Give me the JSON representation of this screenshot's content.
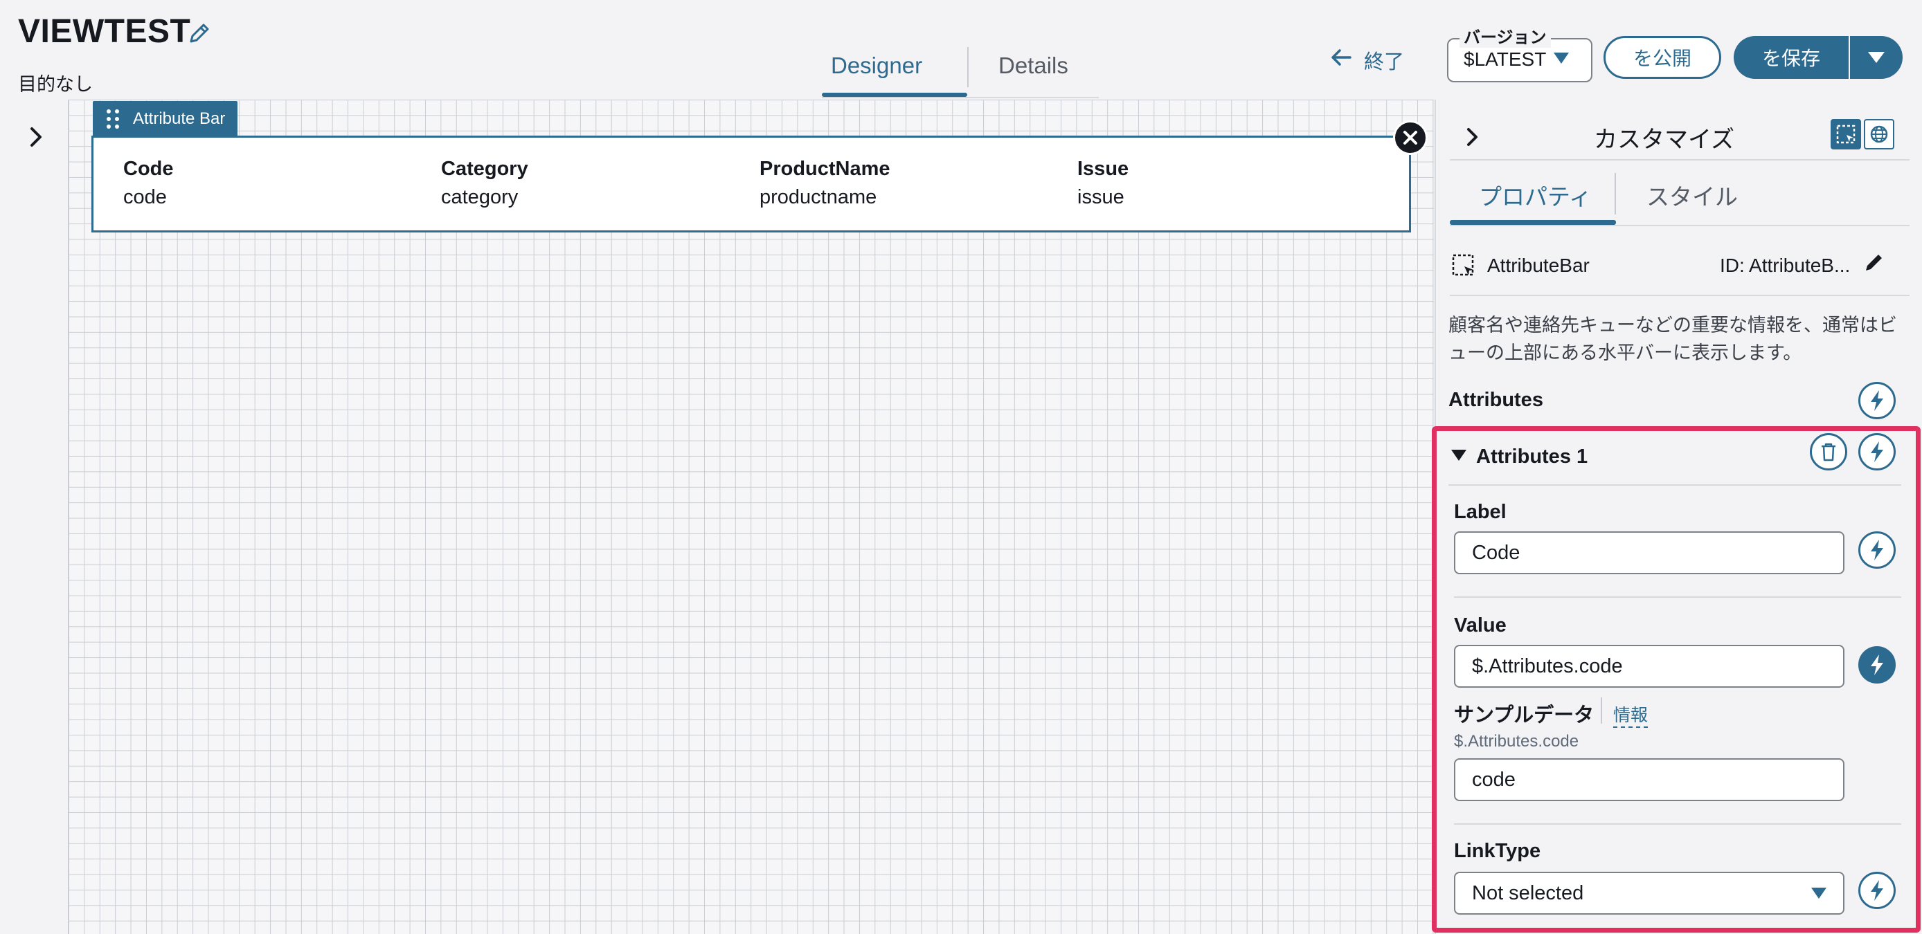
{
  "header": {
    "title": "VIEWTEST",
    "subtitle": "目的なし",
    "tabs": [
      {
        "label": "Designer",
        "active": true
      },
      {
        "label": "Details",
        "active": false
      }
    ],
    "exit_label": "終了",
    "version": {
      "legend": "バージョン",
      "value": "$LATEST"
    },
    "publish_label": "を公開",
    "save_label": "を保存"
  },
  "canvas": {
    "component_tag": "Attribute Bar",
    "attributes": [
      {
        "label": "Code",
        "value": "code"
      },
      {
        "label": "Category",
        "value": "category"
      },
      {
        "label": "ProductName",
        "value": "productname"
      },
      {
        "label": "Issue",
        "value": "issue"
      }
    ]
  },
  "panel": {
    "title": "カスタマイズ",
    "tabs": [
      {
        "label": "プロパティ",
        "active": true
      },
      {
        "label": "スタイル",
        "active": false
      }
    ],
    "component_type": "AttributeBar",
    "component_id": "ID: AttributeB...",
    "description": "顧客名や連絡先キューなどの重要な情報を、通常はビューの上部にある水平バーに表示します。",
    "attributes_heading": "Attributes",
    "group": {
      "title": "Attributes 1",
      "label_field": {
        "label": "Label",
        "value": "Code"
      },
      "value_field": {
        "label": "Value",
        "value": "$.Attributes.code"
      },
      "sample": {
        "label": "サンプルデータ",
        "info": "情報",
        "path": "$.Attributes.code",
        "value": "code"
      },
      "link_type": {
        "label": "LinkType",
        "value": "Not selected"
      }
    }
  },
  "colors": {
    "accent": "#2d6a8f",
    "highlight": "#e0305f"
  },
  "icons": [
    "pencil-icon",
    "arrow-left-icon",
    "caret-down-icon",
    "chevron-right-icon",
    "drag-grip-icon",
    "close-icon",
    "selection-icon",
    "globe-icon",
    "bolt-icon",
    "trash-icon"
  ]
}
